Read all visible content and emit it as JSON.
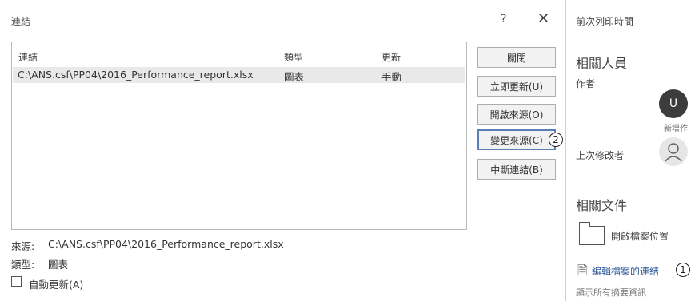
{
  "dialog": {
    "title": "連結",
    "help": "?",
    "close": "✕",
    "columns": {
      "link": "連結",
      "type": "類型",
      "update": "更新"
    },
    "rows": [
      {
        "link": "C:\\ANS.csf\\PP04\\2016_Performance_report.xlsx",
        "type": "圖表",
        "update": "手動"
      }
    ],
    "buttons": {
      "close": "關閉",
      "update_now": "立即更新(U)",
      "open_source": "開啟來源(O)",
      "change_source": "變更來源(C)",
      "break_link": "中斷連結(B)"
    },
    "annotation_2": "2",
    "source_label": "來源:",
    "source_value": "C:\\ANS.csf\\PP04\\2016_Performance_report.xlsx",
    "type_label": "類型:",
    "type_value": "圖表",
    "auto_update_label": "自動更新(A)"
  },
  "right_panel": {
    "last_printed": "前次列印時間",
    "related_people": "相關人員",
    "author_label": "作者",
    "author_initial": "U",
    "add_author": "新增作",
    "last_modified_by": "上次修改者",
    "related_docs": "相關文件",
    "open_file_location": "開啟檔案位置",
    "edit_links": "編輯檔案的連結",
    "annotation_1": "1",
    "show_all": "顯示所有摘要資訊"
  }
}
